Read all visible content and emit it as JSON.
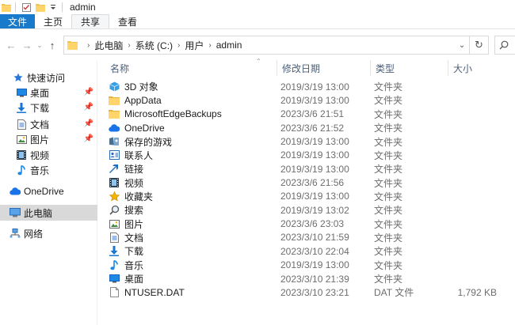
{
  "window": {
    "title": "admin"
  },
  "ribbon": {
    "tabs": [
      "文件",
      "主页",
      "共享",
      "查看"
    ]
  },
  "nav": {
    "breadcrumbs": [
      "此电脑",
      "系统 (C:)",
      "用户",
      "admin"
    ]
  },
  "sidebar": {
    "items": [
      {
        "label": "快速访问",
        "icon": "star-icon",
        "pinned": false
      },
      {
        "label": "桌面",
        "icon": "desktop-icon",
        "pinned": true
      },
      {
        "label": "下载",
        "icon": "download-icon",
        "pinned": true
      },
      {
        "label": "文档",
        "icon": "document-icon",
        "pinned": true
      },
      {
        "label": "图片",
        "icon": "picture-icon",
        "pinned": true
      },
      {
        "label": "视频",
        "icon": "video-icon",
        "pinned": false
      },
      {
        "label": "音乐",
        "icon": "music-icon",
        "pinned": false
      },
      {
        "label": "OneDrive",
        "icon": "cloud-icon",
        "pinned": false
      },
      {
        "label": "此电脑",
        "icon": "computer-icon",
        "pinned": false,
        "selected": true
      },
      {
        "label": "网络",
        "icon": "network-icon",
        "pinned": false
      }
    ]
  },
  "columns": {
    "name": "名称",
    "date": "修改日期",
    "type": "类型",
    "size": "大小"
  },
  "files": [
    {
      "name": "3D 对象",
      "date": "2019/3/19 13:00",
      "type": "文件夹",
      "size": "",
      "icon": "3d-objects-icon"
    },
    {
      "name": "AppData",
      "date": "2019/3/19 13:00",
      "type": "文件夹",
      "size": "",
      "icon": "folder-icon"
    },
    {
      "name": "MicrosoftEdgeBackups",
      "date": "2023/3/6 21:51",
      "type": "文件夹",
      "size": "",
      "icon": "folder-icon"
    },
    {
      "name": "OneDrive",
      "date": "2023/3/6 21:52",
      "type": "文件夹",
      "size": "",
      "icon": "cloud-icon"
    },
    {
      "name": "保存的游戏",
      "date": "2019/3/19 13:00",
      "type": "文件夹",
      "size": "",
      "icon": "saved-games-icon"
    },
    {
      "name": "联系人",
      "date": "2019/3/19 13:00",
      "type": "文件夹",
      "size": "",
      "icon": "contacts-icon"
    },
    {
      "name": "链接",
      "date": "2019/3/19 13:00",
      "type": "文件夹",
      "size": "",
      "icon": "links-icon"
    },
    {
      "name": "视频",
      "date": "2023/3/6 21:56",
      "type": "文件夹",
      "size": "",
      "icon": "video-icon"
    },
    {
      "name": "收藏夹",
      "date": "2019/3/19 13:00",
      "type": "文件夹",
      "size": "",
      "icon": "favorites-icon"
    },
    {
      "name": "搜索",
      "date": "2019/3/19 13:02",
      "type": "文件夹",
      "size": "",
      "icon": "search-icon"
    },
    {
      "name": "图片",
      "date": "2023/3/6 23:03",
      "type": "文件夹",
      "size": "",
      "icon": "picture-icon"
    },
    {
      "name": "文档",
      "date": "2023/3/10 21:59",
      "type": "文件夹",
      "size": "",
      "icon": "document-icon"
    },
    {
      "name": "下载",
      "date": "2023/3/10 22:04",
      "type": "文件夹",
      "size": "",
      "icon": "download-icon"
    },
    {
      "name": "音乐",
      "date": "2019/3/19 13:00",
      "type": "文件夹",
      "size": "",
      "icon": "music-icon"
    },
    {
      "name": "桌面",
      "date": "2023/3/10 21:39",
      "type": "文件夹",
      "size": "",
      "icon": "desktop-icon"
    },
    {
      "name": "NTUSER.DAT",
      "date": "2023/3/10 23:21",
      "type": "DAT 文件",
      "size": "1,792 KB",
      "icon": "file-icon"
    }
  ]
}
